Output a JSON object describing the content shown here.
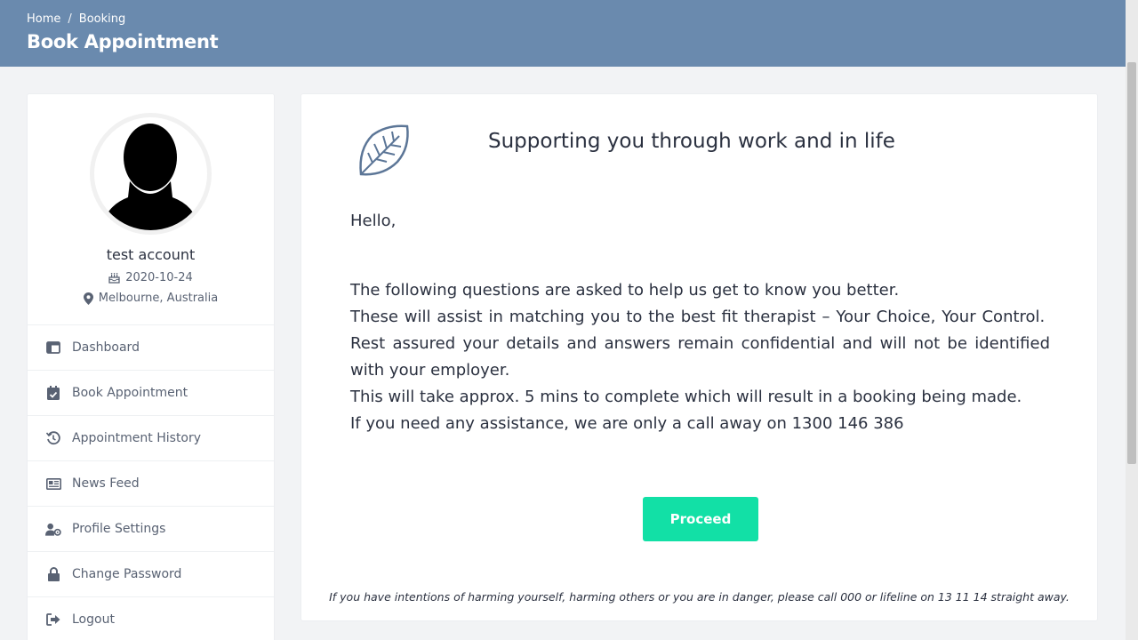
{
  "header": {
    "breadcrumb": [
      "Home",
      "Booking"
    ],
    "breadcrumb_separator": "/",
    "title": "Book Appointment",
    "background_color": "#6a8aae"
  },
  "profile": {
    "name": "test account",
    "dob": "2020-10-24",
    "location": "Melbourne, Australia"
  },
  "sidebar": {
    "items": [
      {
        "label": "Dashboard",
        "icon": "dashboard-icon"
      },
      {
        "label": "Book Appointment",
        "icon": "calendar-check-icon"
      },
      {
        "label": "Appointment History",
        "icon": "history-icon"
      },
      {
        "label": "News Feed",
        "icon": "newspaper-icon"
      },
      {
        "label": "Profile Settings",
        "icon": "user-cog-icon"
      },
      {
        "label": "Change Password",
        "icon": "lock-icon"
      },
      {
        "label": "Logout",
        "icon": "logout-icon"
      }
    ]
  },
  "main": {
    "title": "Supporting you through work and in life",
    "greeting": "Hello,",
    "paragraphs": [
      "The following questions are asked to help us get to know you better.",
      "These will assist in matching you to the best fit therapist – Your Choice, Your Control.  Rest assured your details and answers remain confidential and will not be identified with your employer.",
      "This will take approx. 5 mins to complete which will result in a booking being made.",
      "If you need any assistance, we are only a call away on 1300 146 386"
    ],
    "proceed_label": "Proceed",
    "proceed_color": "#12e0a6",
    "footer_note": "If you have intentions of harming yourself, harming others or you are in danger, please call 000 or lifeline on 13 11 14 straight away."
  }
}
